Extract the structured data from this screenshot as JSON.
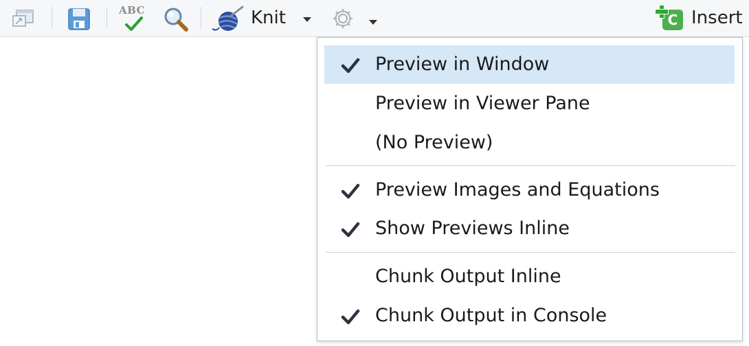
{
  "toolbar": {
    "knit_label": "Knit",
    "insert_label": "Insert",
    "spellcheck_label": "ABC",
    "icons": [
      "open-in-window-icon",
      "save-icon",
      "spellcheck-icon",
      "search-icon",
      "knit-icon",
      "chevron-down-icon",
      "gear-icon",
      "insert-chunk-icon"
    ],
    "insert_badge_letter": "C"
  },
  "menu": {
    "items": [
      {
        "label": "Preview in Window",
        "checked": true,
        "selected": true
      },
      {
        "label": "Preview in Viewer Pane",
        "checked": false,
        "selected": false
      },
      {
        "label": "(No Preview)",
        "checked": false,
        "selected": false
      },
      {
        "label": "Preview Images and Equations",
        "checked": true,
        "selected": false
      },
      {
        "label": "Show Previews Inline",
        "checked": true,
        "selected": false
      },
      {
        "label": "Chunk Output Inline",
        "checked": false,
        "selected": false
      },
      {
        "label": "Chunk Output in Console",
        "checked": true,
        "selected": false
      }
    ]
  },
  "colors": {
    "selection": "#d6e7f7",
    "toolbar_bg": "#f6f7f9",
    "check": "#2b3440",
    "insert_green": "#4cae4c",
    "knit_blue": "#2d4f9e"
  }
}
